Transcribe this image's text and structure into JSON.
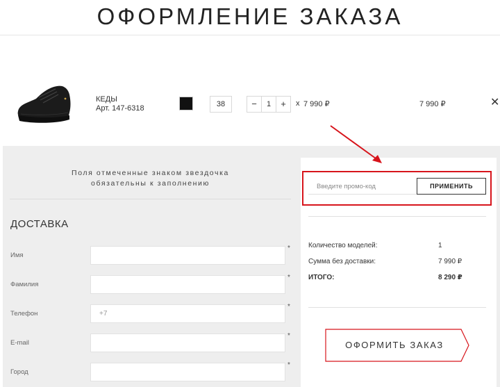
{
  "header": {
    "title": "ОФОРМЛЕНИЕ ЗАКАЗА"
  },
  "cart": {
    "item": {
      "name": "КЕДЫ",
      "article": "Арт. 147-6318",
      "color": "#111111",
      "size": "38",
      "qty_minus": "−",
      "qty": "1",
      "qty_plus": "+",
      "times": "x",
      "unit_price": "7 990 ₽",
      "total": "7 990 ₽",
      "remove": "✕"
    }
  },
  "form": {
    "note_line1": "Поля отмеченные знаком звездочка",
    "note_line2": "обязательны к заполнению",
    "section_title": "ДОСТАВКА",
    "fields": [
      {
        "label": "Имя",
        "value": ""
      },
      {
        "label": "Фамилия",
        "value": ""
      },
      {
        "label": "Телефон",
        "value": "",
        "placeholder": "+7"
      },
      {
        "label": "E-mail",
        "value": ""
      },
      {
        "label": "Город",
        "value": ""
      }
    ],
    "required_mark": "*"
  },
  "summary": {
    "promo_placeholder": "Введите промо-код",
    "promo_button": "ПРИМЕНИТЬ",
    "models_label": "Количество моделей:",
    "models_value": "1",
    "subtotal_label": "Сумма без доставки:",
    "subtotal_value": "7 990 ₽",
    "total_label": "ИТОГО:",
    "total_value": "8 290 ₽",
    "order_button": "ОФОРМИТЬ ЗАКАЗ"
  },
  "colors": {
    "annotation_red": "#d7141b",
    "background_grey": "#eeeeee"
  }
}
